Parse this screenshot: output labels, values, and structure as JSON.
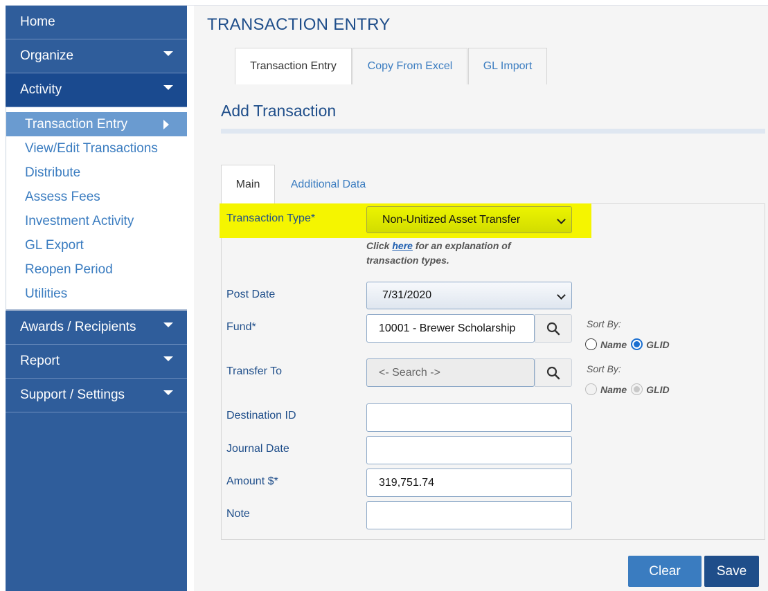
{
  "sidebar": {
    "home": "Home",
    "organize": "Organize",
    "activity": "Activity",
    "activity_items": [
      "Transaction Entry",
      "View/Edit Transactions",
      "Distribute",
      "Assess Fees",
      "Investment Activity",
      "GL Export",
      "Reopen Period",
      "Utilities"
    ],
    "awards": "Awards / Recipients",
    "report": "Report",
    "support": "Support / Settings"
  },
  "page": {
    "title": "TRANSACTION ENTRY",
    "tabs": [
      "Transaction Entry",
      "Copy From Excel",
      "GL Import"
    ],
    "section_title": "Add Transaction",
    "form_tabs": [
      "Main",
      "Additional Data"
    ]
  },
  "form": {
    "transaction_type_label": "Transaction Type*",
    "transaction_type_value": "Non-Unitized Asset Transfer",
    "hint_prefix": "Click",
    "hint_link": "here",
    "hint_suffix": "for an explanation of transaction types.",
    "post_date_label": "Post Date",
    "post_date_value": "7/31/2020",
    "fund_label": "Fund*",
    "fund_value": "10001 - Brewer Scholarship",
    "transfer_to_label": "Transfer To",
    "transfer_to_placeholder": "<- Search ->",
    "destination_id_label": "Destination ID",
    "destination_id_value": "",
    "journal_date_label": "Journal Date",
    "journal_date_value": "",
    "amount_label": "Amount $*",
    "amount_value": "319,751.74",
    "note_label": "Note",
    "note_value": "",
    "sort_by_label": "Sort By:",
    "sort_name": "Name",
    "sort_glid": "GLID",
    "fund_sort_selected": "GLID",
    "transfer_sort_selected": "GLID"
  },
  "buttons": {
    "clear": "Clear",
    "save": "Save"
  },
  "colors": {
    "sidebar_bg": "#2f5d9b",
    "sidebar_active": "#1a4a8f",
    "highlight": "#f5f500",
    "clear_button": "#3a7cc0",
    "save_button": "#1f4e8a",
    "title": "#1f4e8a"
  }
}
